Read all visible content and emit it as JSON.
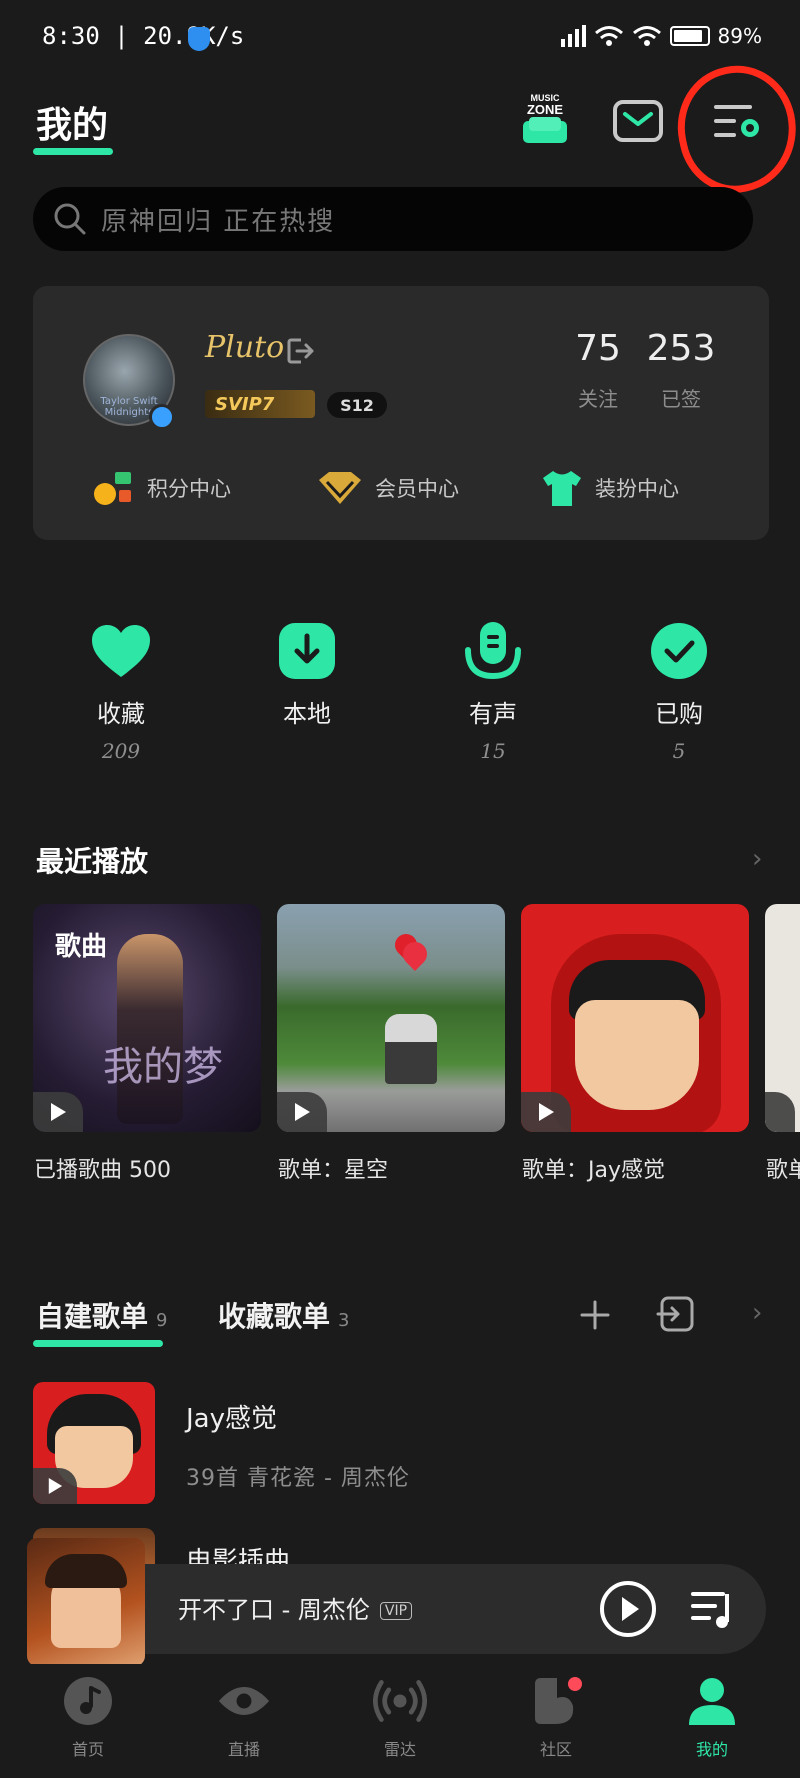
{
  "status_bar": {
    "time": "8:30 | 20.9K/s",
    "battery": "89%"
  },
  "header": {
    "title": "我的",
    "music_zone_text": "MUSIC\nZONE"
  },
  "search": {
    "placeholder": "原神回归  正在热搜"
  },
  "profile": {
    "username": "Pluto",
    "avatar_caption": "Taylor Swift Midnights",
    "svip_badge": "SVIP7",
    "level_badge": "S12",
    "stats": [
      {
        "value": "75",
        "label": "关注"
      },
      {
        "value": "253",
        "label": "已签"
      }
    ],
    "links": [
      {
        "label": "积分中心",
        "icon": "points-icon"
      },
      {
        "label": "会员中心",
        "icon": "vip-diamond-icon"
      },
      {
        "label": "装扮中心",
        "icon": "tshirt-icon"
      }
    ]
  },
  "quick_actions": [
    {
      "label": "收藏",
      "count": "209",
      "icon": "heart-icon"
    },
    {
      "label": "本地",
      "count": "",
      "icon": "download-icon"
    },
    {
      "label": "有声",
      "count": "15",
      "icon": "microphone-icon"
    },
    {
      "label": "已购",
      "count": "5",
      "icon": "check-icon"
    }
  ],
  "recent": {
    "title": "最近播放",
    "items": [
      {
        "caption": "已播歌曲 500",
        "overlay": "歌曲",
        "cover_text": "我的梦"
      },
      {
        "caption": "歌单：星空"
      },
      {
        "caption": "歌单：Jay感觉"
      },
      {
        "caption": "歌单"
      }
    ]
  },
  "playlists": {
    "tabs": [
      {
        "label": "自建歌单",
        "count": "9"
      },
      {
        "label": "收藏歌单",
        "count": "3"
      }
    ],
    "items": [
      {
        "name": "Jay感觉",
        "meta": "39首 青花瓷 - 周杰伦"
      },
      {
        "name": "电影插曲",
        "meta": ""
      }
    ]
  },
  "player": {
    "song": "开不了口 - 周杰伦",
    "vip": "VIP"
  },
  "bottom_nav": [
    {
      "label": "首页",
      "icon": "music-note-icon"
    },
    {
      "label": "直播",
      "icon": "eye-icon"
    },
    {
      "label": "雷达",
      "icon": "radar-icon"
    },
    {
      "label": "社区",
      "icon": "community-icon"
    },
    {
      "label": "我的",
      "icon": "person-icon"
    }
  ],
  "colors": {
    "accent": "#2ee6a6",
    "background": "#1b1b1b",
    "card": "#2a2a2a",
    "gold": "#e7c36a",
    "annotation": "#ff2a1a"
  }
}
